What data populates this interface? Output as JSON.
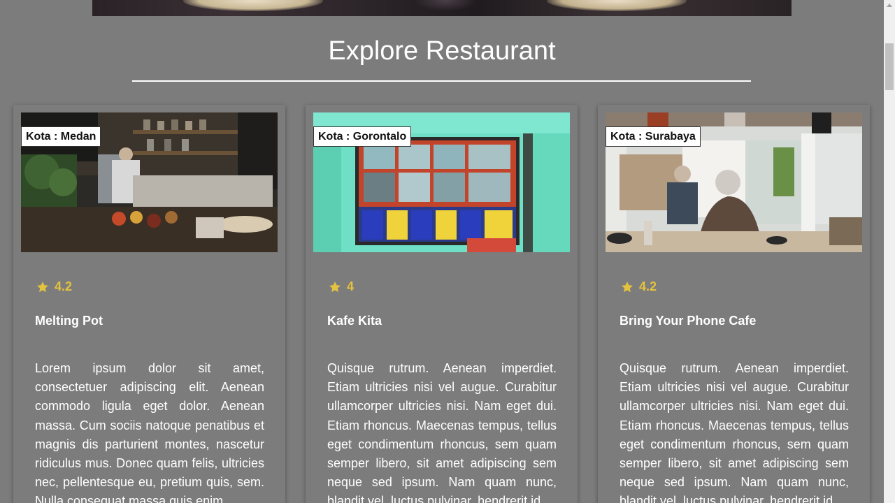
{
  "section": {
    "title": "Explore Restaurant"
  },
  "restaurants": [
    {
      "city_label": "Kota : Medan",
      "rating": "4.2",
      "name": "Melting Pot",
      "description": "Lorem ipsum dolor sit amet, consectetuer adipiscing elit. Aenean commodo ligula eget dolor. Aenean massa. Cum sociis natoque penatibus et magnis dis parturient montes, nascetur ridiculus mus. Donec quam felis, ultricies nec, pellentesque eu, pretium quis, sem. Nulla consequat massa quis enim."
    },
    {
      "city_label": "Kota : Gorontalo",
      "rating": "4",
      "name": "Kafe Kita",
      "description": "Quisque rutrum. Aenean imperdiet. Etiam ultricies nisi vel augue. Curabitur ullamcorper ultricies nisi. Nam eget dui. Etiam rhoncus. Maecenas tempus, tellus eget condimentum rhoncus, sem quam semper libero, sit amet adipiscing sem neque sed ipsum. Nam quam nunc, blandit vel, luctus pulvinar, hendrerit id,"
    },
    {
      "city_label": "Kota : Surabaya",
      "rating": "4.2",
      "name": "Bring Your Phone Cafe",
      "description": "Quisque rutrum. Aenean imperdiet. Etiam ultricies nisi vel augue. Curabitur ullamcorper ultricies nisi. Nam eget dui. Etiam rhoncus. Maecenas tempus, tellus eget condimentum rhoncus, sem quam semper libero, sit amet adipiscing sem neque sed ipsum. Nam quam nunc, blandit vel, luctus pulvinar, hendrerit id,"
    }
  ],
  "icons": {
    "rating": "star-icon"
  },
  "colors": {
    "background": "#7c7c7c",
    "rating_accent": "#e3c240",
    "text": "#ffffff"
  }
}
